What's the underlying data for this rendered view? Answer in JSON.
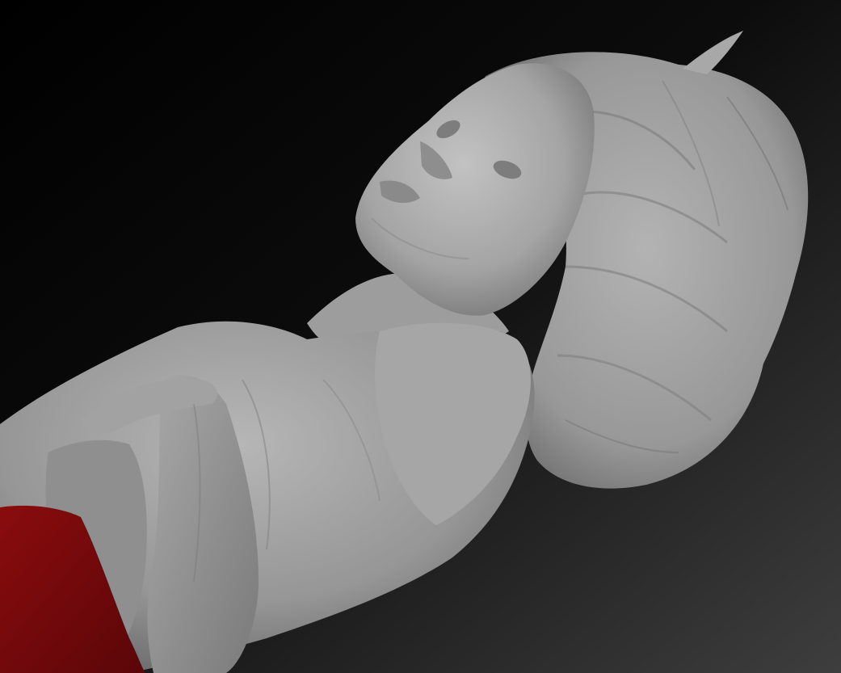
{
  "app": {
    "name": "",
    "document_title": ""
  },
  "viewport": {
    "background_top": "#000000",
    "background_bottom": "#3e3e3e",
    "sculpt_base_color": "#9b9b9b",
    "sculpt_highlight_color": "#c4c4c4",
    "sculpt_shadow_color": "#5e5e5e",
    "masked_region_color": "#7a0a0c"
  },
  "scene": {
    "model": "female-bust-sculpt",
    "material": "matcap-gray",
    "has_mask": true
  }
}
